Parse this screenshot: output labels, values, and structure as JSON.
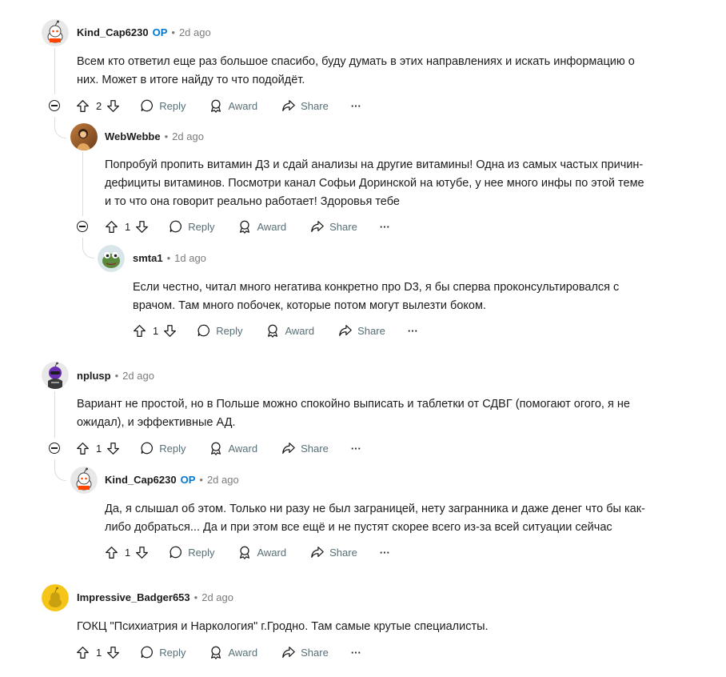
{
  "comments": [
    {
      "author": "Kind_Cap6230",
      "op": "OP",
      "age": "2d ago",
      "lines": [
        "Всем кто ответил еще раз большое спасибо, буду думать в этих направлениях и искать информацию о",
        "них. Может в итоге найду то что подойдёт."
      ],
      "votes": "2"
    },
    {
      "author": "WebWebbe",
      "age": "2d ago",
      "lines": [
        "Попробуй пропить витамин Д3 и сдай анализы на другие витамины! Одна из самых частых причин-",
        "дефициты витаминов. Посмотри канал Софьи Доринской на ютубе, у нее много инфы по этой теме",
        "и то что она говорит реально работает! Здоровья тебе"
      ],
      "votes": "1"
    },
    {
      "author": "smta1",
      "age": "1d ago",
      "lines": [
        "Если честно, читал много негатива конкретно про D3, я бы сперва проконсультировался с",
        "врачом. Там много побочек, которые потом могут вылезти боком."
      ],
      "votes": "1"
    },
    {
      "author": "nplusp",
      "age": "2d ago",
      "lines": [
        "Вариант не простой, но в Польше можно спокойно выписать и таблетки от СДВГ (помогают огого, я не",
        "ожидал), и эффективные АД."
      ],
      "votes": "1"
    },
    {
      "author": "Kind_Cap6230",
      "op": "OP",
      "age": "2d ago",
      "lines": [
        "Да, я слышал об этом. Только ни разу не был заграницей, нету загранника и даже денег что бы как-",
        "либо добраться... Да и при этом все ещё и не пустят скорее всего из-за всей ситуации сейчас"
      ],
      "votes": "1"
    },
    {
      "author": "Impressive_Badger653",
      "age": "2d ago",
      "lines": [
        "ГОКЦ \"Психиатрия и Наркология\" г.Гродно. Там самые крутые специалисты."
      ],
      "votes": "1"
    }
  ],
  "actions": {
    "reply": "Reply",
    "award": "Award",
    "share": "Share",
    "more": "···"
  },
  "icons": [
    "upvote-icon",
    "downvote-icon",
    "comment-icon",
    "award-icon",
    "share-icon",
    "collapse-icon"
  ],
  "colors": {
    "op": "#0079d3",
    "meta": "#7c7c7c",
    "thread": "#dcdcdc"
  }
}
